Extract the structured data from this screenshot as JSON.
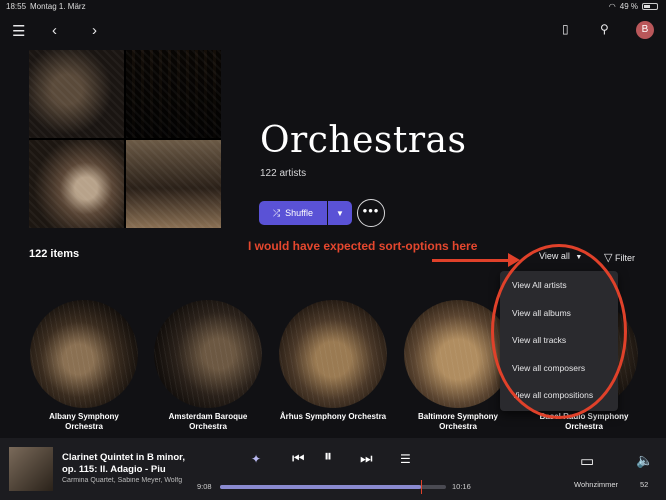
{
  "status_bar": {
    "time": "18:55",
    "date": "Montag 1. März",
    "battery": "49 %"
  },
  "topbar": {
    "avatar_initial": "B"
  },
  "header": {
    "title": "Orchestras",
    "subtitle": "122 artists",
    "shuffle_label": "Shuffle",
    "more_label": "•••"
  },
  "list": {
    "count_label": "122 items",
    "view_label": "View all",
    "filter_label": "Filter"
  },
  "annotation": {
    "text": "I would have expected sort-options here",
    "color": "#e0412a"
  },
  "dropdown": {
    "options": [
      "View All artists",
      "View all albums",
      "View all tracks",
      "View all composers",
      "View all compositions"
    ]
  },
  "artists": [
    {
      "name": "Albany Symphony Orchestra"
    },
    {
      "name": "Amsterdam Baroque Orchestra"
    },
    {
      "name": "Århus Symphony Orchestra"
    },
    {
      "name": "Baltimore Symphony Orchestra"
    },
    {
      "name": "Basel Radio Symphony Orchestra"
    }
  ],
  "player": {
    "track_title": "Clarinet Quintet in B minor, op. 115: II. Adagio - Piu",
    "track_artist": "Carmina Quartet, Sabine Meyer, Wolfg",
    "elapsed": "9:08",
    "duration": "10:16",
    "progress_fraction": 0.89,
    "zone": "Wohnzimmer",
    "volume": "52"
  },
  "colors": {
    "accent": "#5a52d6",
    "annotation": "#e0412a",
    "background": "#111114"
  }
}
